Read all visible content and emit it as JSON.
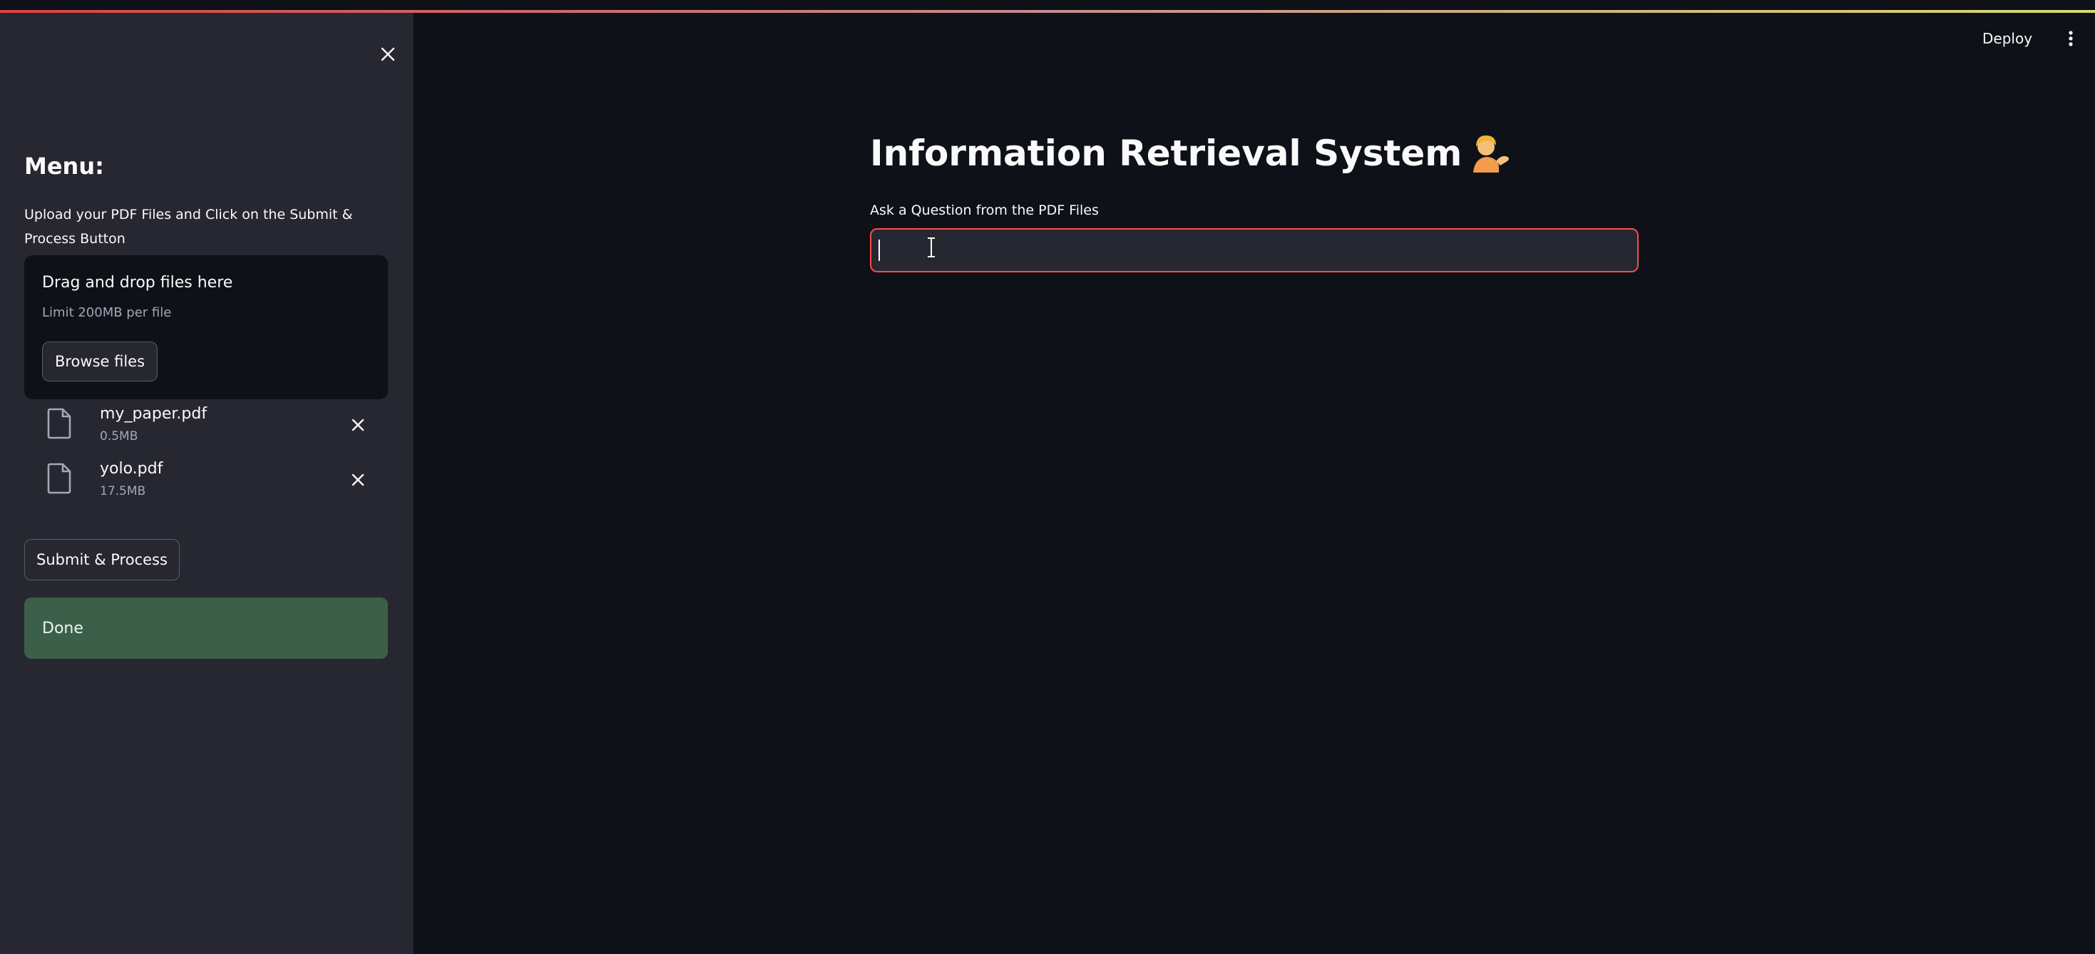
{
  "sidebar": {
    "menu_title": "Menu:",
    "description": "Upload your PDF Files and Click on the Submit & Process Button",
    "uploader": {
      "drop_title": "Drag and drop files here",
      "limit_text": "Limit 200MB per file",
      "browse_label": "Browse files"
    },
    "files": [
      {
        "name": "my_paper.pdf",
        "size": "0.5MB"
      },
      {
        "name": "yolo.pdf",
        "size": "17.5MB"
      }
    ],
    "submit_label": "Submit & Process",
    "status_text": "Done"
  },
  "header": {
    "deploy_label": "Deploy"
  },
  "main": {
    "title": "Information Retrieval System",
    "question_label": "Ask a Question from the PDF Files",
    "question_value": "",
    "question_placeholder": ""
  },
  "colors": {
    "background": "#0e1117",
    "sidebar": "#262730",
    "accent": "#ff4b4b",
    "success": "#3c5f49"
  },
  "icons": {
    "close": "close-icon",
    "file": "file-icon",
    "menu": "kebab-menu-icon",
    "title_emoji": "person-tipping-hand-emoji"
  }
}
